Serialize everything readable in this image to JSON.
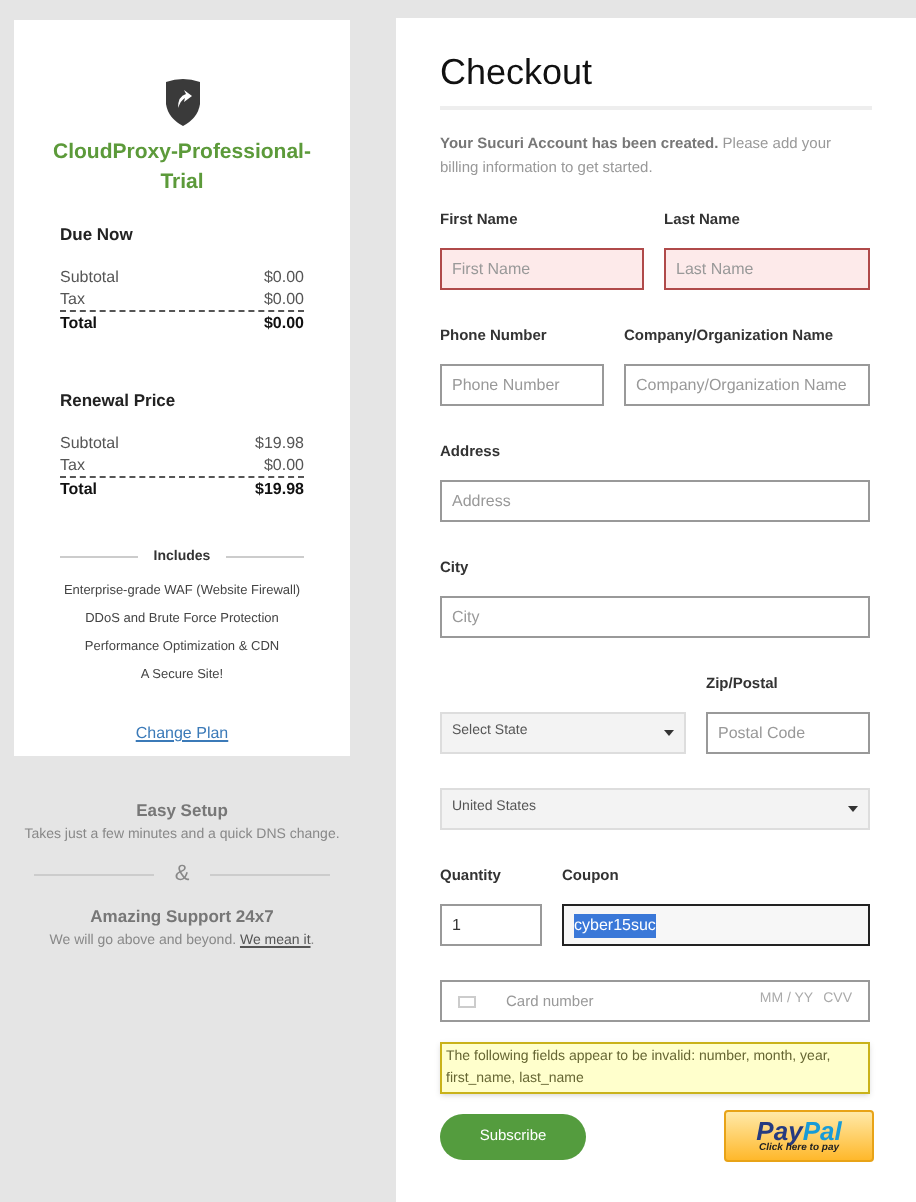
{
  "plan": {
    "name": "CloudProxy-Professional-Trial",
    "sections": [
      {
        "title": "Due Now",
        "rows": [
          {
            "label": "Subtotal",
            "value": "$0.00"
          },
          {
            "label": "Tax",
            "value": "$0.00"
          }
        ],
        "total": {
          "label": "Total",
          "value": "$0.00"
        }
      },
      {
        "title": "Renewal Price",
        "rows": [
          {
            "label": "Subtotal",
            "value": "$19.98"
          },
          {
            "label": "Tax",
            "value": "$0.00"
          }
        ],
        "total": {
          "label": "Total",
          "value": "$19.98"
        }
      }
    ],
    "includes_heading": "Includes",
    "includes": [
      "Enterprise-grade WAF (Website Firewall)",
      "DDoS and Brute Force Protection",
      "Performance Optimization & CDN",
      "A Secure Site!"
    ],
    "change_plan_link": "Change Plan"
  },
  "features": [
    {
      "title": "Easy Setup",
      "text": "Takes just a few minutes and a quick DNS change."
    },
    {
      "title": "Amazing Support 24x7",
      "text": "We will go above and beyond.",
      "link": "We mean it",
      "after_link": "."
    }
  ],
  "separator": "&",
  "checkout": {
    "title": "Checkout",
    "notice_bold": "Your Sucuri Account has been created.",
    "notice": "Please add your billing information to get started.",
    "rows": [
      [
        {
          "kind": "text",
          "label": "First Name",
          "placeholder": "First Name",
          "invalid": true
        },
        {
          "kind": "text",
          "label": "Last Name",
          "placeholder": "Last Name",
          "invalid": true
        }
      ],
      [
        {
          "kind": "text",
          "label": "Phone Number",
          "placeholder": "Phone Number",
          "invalid": false
        },
        {
          "kind": "text",
          "label": "Company/Organization Name",
          "placeholder": "Company/Organization Name",
          "invalid": false
        }
      ],
      [
        {
          "kind": "text",
          "label": "Address",
          "placeholder": "Address",
          "invalid": false
        }
      ],
      [
        {
          "kind": "text",
          "label": "City",
          "placeholder": "City",
          "invalid": false
        }
      ],
      [
        {
          "kind": "select",
          "value": "Select State"
        },
        {
          "kind": "text",
          "label": "Zip/Postal",
          "placeholder": "Postal Code",
          "invalid": false
        }
      ],
      [
        {
          "kind": "select",
          "value": "United States"
        }
      ],
      [
        {
          "kind": "text",
          "label": "Quantity",
          "value": "1",
          "invalid": false
        },
        {
          "kind": "text",
          "label": "Coupon",
          "value": "cyber15suc",
          "invalid": false,
          "focused": true
        }
      ]
    ],
    "card": {
      "placeholder": "Card number",
      "expiry": "MM / YY",
      "cvv": "CVV"
    },
    "error": "The following fields appear to be invalid: number, month, year, first_name, last_name",
    "subscribe": "Subscribe",
    "paypal": {
      "logo_dark": "Pay",
      "logo_light": "Pal",
      "caption": "Click here to pay"
    }
  }
}
